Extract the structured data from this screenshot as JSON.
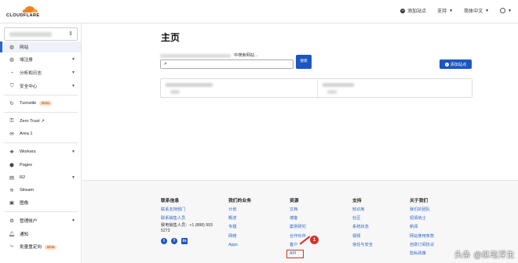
{
  "header": {
    "logo_text": "CLOUDFLARE",
    "add_site_label": "添加站点",
    "support_label": "支持",
    "language_label": "简体中文"
  },
  "sidebar": {
    "items": [
      {
        "label": "网站",
        "icon": "globe-icon"
      },
      {
        "label": "域注册",
        "icon": "globe-icon"
      },
      {
        "label": "分析和日志",
        "icon": "clock-icon"
      },
      {
        "label": "安全中心",
        "icon": "shield-icon"
      },
      {
        "label": "Turnstile",
        "icon": "refresh-icon",
        "badge": "Beta"
      },
      {
        "label": "Zero Trust",
        "icon": "key-icon"
      },
      {
        "label": "Area 1",
        "icon": "mail-icon"
      },
      {
        "label": "Workers",
        "icon": "workers-icon"
      },
      {
        "label": "Pages",
        "icon": "pages-icon"
      },
      {
        "label": "R2",
        "icon": "database-icon"
      },
      {
        "label": "Stream",
        "icon": "stream-icon"
      },
      {
        "label": "图像",
        "icon": "image-icon"
      },
      {
        "label": "管理帐户",
        "icon": "gear-icon"
      },
      {
        "label": "通知",
        "icon": "bell-icon"
      },
      {
        "label": "批量重定向",
        "icon": "redirect-icon",
        "badge": "Beta"
      }
    ]
  },
  "main": {
    "title": "主页",
    "search_label": "中搜索网站...",
    "search_button": "搜索",
    "add_site_button": "添加站点"
  },
  "footer": {
    "contact": {
      "heading": "联系信息",
      "links": [
        "联系支持部门",
        "联系销售人员"
      ],
      "phone": "致电销售人员：+1 (888) 993 5273"
    },
    "business": {
      "heading": "我们的业务",
      "links": [
        "计划",
        "概述",
        "专题",
        "网络",
        "Apps"
      ]
    },
    "resources": {
      "heading": "资源",
      "links": [
        "文档",
        "博客",
        "案例研究",
        "合作伙伴",
        "客户",
        "API"
      ]
    },
    "support": {
      "heading": "支持",
      "links": [
        "知识库",
        "社区",
        "系统状态",
        "视频",
        "信任与安全"
      ]
    },
    "about": {
      "heading": "关于我们",
      "links": [
        "我们的团队",
        "招贤纳士",
        "新闻",
        "网站使用条款",
        "自助订阅协议",
        "隐私政策"
      ]
    }
  },
  "annotation": {
    "badge": "1"
  },
  "watermark": "头条 @纵笔浮生",
  "colors": {
    "accent": "#1d56c2",
    "annotation_red": "#d93025",
    "beta_bg": "#fbd9bc"
  }
}
